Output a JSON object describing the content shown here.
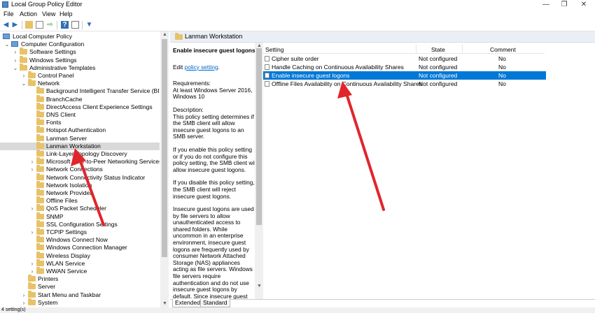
{
  "window": {
    "title": "Local Group Policy Editor",
    "controls": {
      "minimize": "—",
      "maximize": "❐",
      "close": "✕"
    }
  },
  "menu": [
    "File",
    "Action",
    "View",
    "Help"
  ],
  "toolbar": [
    "back-icon",
    "forward-icon",
    "folder-up-icon",
    "show-hide-tree-icon",
    "export-icon",
    "help-icon",
    "properties-icon",
    "filter-icon"
  ],
  "tree": [
    {
      "label": "Local Computer Policy",
      "level": 0,
      "expander": "",
      "icon": "computer"
    },
    {
      "label": "Computer Configuration",
      "level": 1,
      "expander": "v",
      "icon": "computer"
    },
    {
      "label": "Software Settings",
      "level": 2,
      "expander": ">",
      "icon": "folder"
    },
    {
      "label": "Windows Settings",
      "level": 2,
      "expander": ">",
      "icon": "folder"
    },
    {
      "label": "Administrative Templates",
      "level": 2,
      "expander": "v",
      "icon": "folder"
    },
    {
      "label": "Control Panel",
      "level": 3,
      "expander": ">",
      "icon": "folder"
    },
    {
      "label": "Network",
      "level": 3,
      "expander": "v",
      "icon": "folder"
    },
    {
      "label": "Background Intelligent Transfer Service (BITS)",
      "level": 4,
      "expander": "",
      "icon": "folder"
    },
    {
      "label": "BranchCache",
      "level": 4,
      "expander": "",
      "icon": "folder"
    },
    {
      "label": "DirectAccess Client Experience Settings",
      "level": 4,
      "expander": "",
      "icon": "folder"
    },
    {
      "label": "DNS Client",
      "level": 4,
      "expander": "",
      "icon": "folder"
    },
    {
      "label": "Fonts",
      "level": 4,
      "expander": "",
      "icon": "folder"
    },
    {
      "label": "Hotspot Authentication",
      "level": 4,
      "expander": "",
      "icon": "folder"
    },
    {
      "label": "Lanman Server",
      "level": 4,
      "expander": "",
      "icon": "folder"
    },
    {
      "label": "Lanman Workstation",
      "level": 4,
      "expander": "",
      "icon": "folder",
      "selected": true
    },
    {
      "label": "Link-Layer Topology Discovery",
      "level": 4,
      "expander": "",
      "icon": "folder"
    },
    {
      "label": "Microsoft Peer-to-Peer Networking Services",
      "level": 4,
      "expander": ">",
      "icon": "folder"
    },
    {
      "label": "Network Connections",
      "level": 4,
      "expander": ">",
      "icon": "folder"
    },
    {
      "label": "Network Connectivity Status Indicator",
      "level": 4,
      "expander": "",
      "icon": "folder"
    },
    {
      "label": "Network Isolation",
      "level": 4,
      "expander": "",
      "icon": "folder"
    },
    {
      "label": "Network Provider",
      "level": 4,
      "expander": "",
      "icon": "folder"
    },
    {
      "label": "Offline Files",
      "level": 4,
      "expander": "",
      "icon": "folder"
    },
    {
      "label": "QoS Packet Scheduler",
      "level": 4,
      "expander": ">",
      "icon": "folder"
    },
    {
      "label": "SNMP",
      "level": 4,
      "expander": "",
      "icon": "folder"
    },
    {
      "label": "SSL Configuration Settings",
      "level": 4,
      "expander": "",
      "icon": "folder"
    },
    {
      "label": "TCPIP Settings",
      "level": 4,
      "expander": ">",
      "icon": "folder"
    },
    {
      "label": "Windows Connect Now",
      "level": 4,
      "expander": "",
      "icon": "folder"
    },
    {
      "label": "Windows Connection Manager",
      "level": 4,
      "expander": "",
      "icon": "folder"
    },
    {
      "label": "Wireless Display",
      "level": 4,
      "expander": "",
      "icon": "folder"
    },
    {
      "label": "WLAN Service",
      "level": 4,
      "expander": ">",
      "icon": "folder"
    },
    {
      "label": "WWAN Service",
      "level": 4,
      "expander": ">",
      "icon": "folder"
    },
    {
      "label": "Printers",
      "level": 3,
      "expander": "",
      "icon": "folder"
    },
    {
      "label": "Server",
      "level": 3,
      "expander": "",
      "icon": "folder"
    },
    {
      "label": "Start Menu and Taskbar",
      "level": 3,
      "expander": ">",
      "icon": "folder"
    },
    {
      "label": "System",
      "level": 3,
      "expander": ">",
      "icon": "folder"
    }
  ],
  "right_header": {
    "title": "Lanman Workstation"
  },
  "description": {
    "heading": "Enable insecure guest logons",
    "edit_prefix": "Edit ",
    "edit_link": "policy setting",
    "edit_suffix": ".",
    "requirements": "Requirements:\nAt least Windows Server 2016, Windows 10",
    "desc1": "Description:\nThis policy setting determines if the SMB client will allow insecure guest logons to an SMB server.",
    "desc2": "If you enable this policy setting or if you do not configure this policy setting, the SMB client will allow insecure guest logons.",
    "desc3": "If you disable this policy setting, the SMB client will reject insecure guest logons.",
    "desc4": "Insecure guest logons are used by file servers to allow unauthenticated access to shared folders. While uncommon in an enterprise environment, insecure guest logons are frequently used by consumer Network Attached Storage (NAS) appliances acting as file servers. Windows file servers require authentication and do not use insecure guest logons by default. Since insecure guest logons are unauthenticated, important security features such as SMB Signing and SMB Encryption are disabled. As a"
  },
  "grid": {
    "columns": [
      "Setting",
      "State",
      "Comment"
    ],
    "rows": [
      {
        "setting": "Cipher suite order",
        "state": "Not configured",
        "comment": "No"
      },
      {
        "setting": "Handle Caching on Continuous Availability Shares",
        "state": "Not configured",
        "comment": "No"
      },
      {
        "setting": "Enable insecure guest logons",
        "state": "Not configured",
        "comment": "No",
        "selected": true
      },
      {
        "setting": "Offline Files Availability on Continuous Availability Shares",
        "state": "Not configured",
        "comment": "No"
      }
    ]
  },
  "tabs": [
    "Extended",
    "Standard"
  ],
  "status": "4 setting(s)",
  "colors": {
    "selection": "#0078d7",
    "annotation_arrow": "#e0262c",
    "folder": "#e8c268"
  }
}
